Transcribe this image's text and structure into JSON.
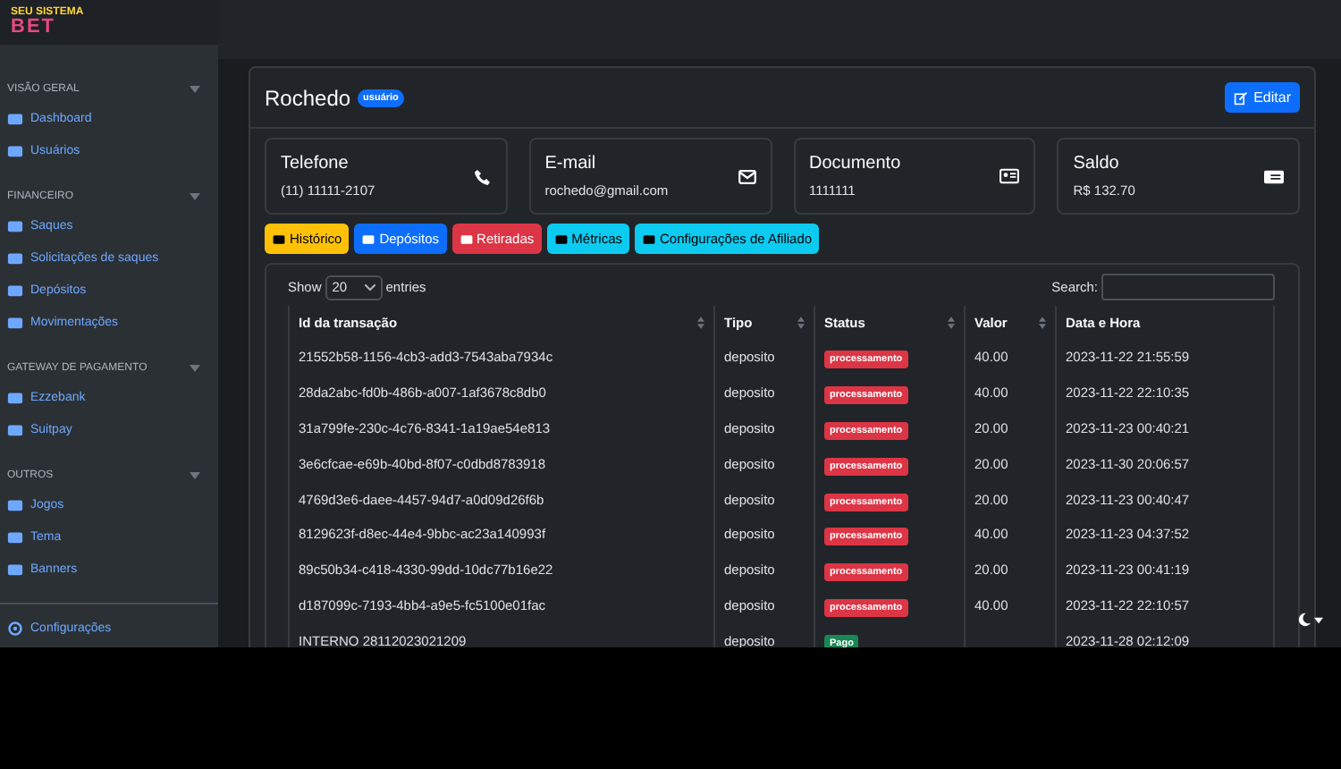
{
  "logo": {
    "line1": "SEU SISTEMA",
    "line2": "BET"
  },
  "sidebar": {
    "sections": [
      {
        "title": "VISÃO GERAL",
        "expanded": true,
        "items": [
          {
            "label": "Dashboard"
          },
          {
            "label": "Usuários"
          }
        ]
      },
      {
        "title": "FINANCEIRO",
        "expanded": true,
        "items": [
          {
            "label": "Saques"
          },
          {
            "label": "Solicitações de saques"
          },
          {
            "label": "Depósitos"
          },
          {
            "label": "Movimentações"
          }
        ]
      },
      {
        "title": "GATEWAY DE PAGAMENTO",
        "expanded": true,
        "items": [
          {
            "label": "Ezzebank"
          },
          {
            "label": "Suitpay"
          }
        ]
      },
      {
        "title": "OUTROS",
        "expanded": true,
        "items": [
          {
            "label": "Jogos"
          },
          {
            "label": "Tema"
          },
          {
            "label": "Banners"
          }
        ]
      }
    ],
    "footer_item": {
      "label": "Configurações"
    }
  },
  "profile": {
    "name": "Rochedo",
    "badge": "usuário",
    "edit_button": "Editar"
  },
  "info_cards": [
    {
      "title": "Telefone",
      "value": "(11) 11111-2107"
    },
    {
      "title": "E-mail",
      "value": "rochedo@gmail.com"
    },
    {
      "title": "Documento",
      "value": "1111111"
    },
    {
      "title": "Saldo",
      "value": "R$ 132.70"
    }
  ],
  "tabs": [
    {
      "label": "Histórico",
      "color": "#ffc107"
    },
    {
      "label": "Depósitos",
      "color": "#0d6efd"
    },
    {
      "label": "Retiradas",
      "color": "#dc3545"
    },
    {
      "label": "Métricas",
      "color": "#0dcaf0"
    },
    {
      "label": "Configurações de Afiliado",
      "color": "#0dcaf0"
    }
  ],
  "table_controls": {
    "show_label": "Show",
    "page_size": "20",
    "entries_label": "entries",
    "search_label": "Search:"
  },
  "table": {
    "columns": [
      "Id da transação",
      "Tipo",
      "Status",
      "Valor",
      "Data e Hora"
    ],
    "rows": [
      {
        "id": "21552b58-1156-4cb3-add3-7543aba7934c",
        "type": "deposito",
        "status": "processamento",
        "color": "#dc3545",
        "value": "40.00",
        "date": "2023-11-22 21:55:59"
      },
      {
        "id": "28da2abc-fd0b-486b-a007-1af3678c8db0",
        "type": "deposito",
        "status": "processamento",
        "color": "#dc3545",
        "value": "40.00",
        "date": "2023-11-22 22:10:35"
      },
      {
        "id": "31a799fe-230c-4c76-8341-1a19ae54e813",
        "type": "deposito",
        "status": "processamento",
        "color": "#dc3545",
        "value": "20.00",
        "date": "2023-11-23 00:40:21"
      },
      {
        "id": "3e6cfcae-e69b-40bd-8f07-c0dbd8783918",
        "type": "deposito",
        "status": "processamento",
        "color": "#dc3545",
        "value": "20.00",
        "date": "2023-11-30 20:06:57"
      },
      {
        "id": "4769d3e6-daee-4457-94d7-a0d09d26f6b",
        "type": "deposito",
        "status": "processamento",
        "color": "#dc3545",
        "value": "20.00",
        "date": "2023-11-23 00:40:47"
      },
      {
        "id": "8129623f-d8ec-44e4-9bbc-ac23a140993f",
        "type": "deposito",
        "status": "processamento",
        "color": "#dc3545",
        "value": "40.00",
        "date": "2023-11-23 04:37:52"
      },
      {
        "id": "89c50b34-c418-4330-99dd-10dc77b16e22",
        "type": "deposito",
        "status": "processamento",
        "color": "#dc3545",
        "value": "20.00",
        "date": "2023-11-23 00:41:19"
      },
      {
        "id": "d187099c-7193-4bb4-a9e5-fc5100e01fac",
        "type": "deposito",
        "status": "processamento",
        "color": "#dc3545",
        "value": "40.00",
        "date": "2023-11-22 22:10:57"
      },
      {
        "id": "INTERNO 28112023021209",
        "type": "deposito",
        "status": "Pago",
        "color": "#198754",
        "date": "2023-11-28 02:12:09"
      }
    ]
  }
}
